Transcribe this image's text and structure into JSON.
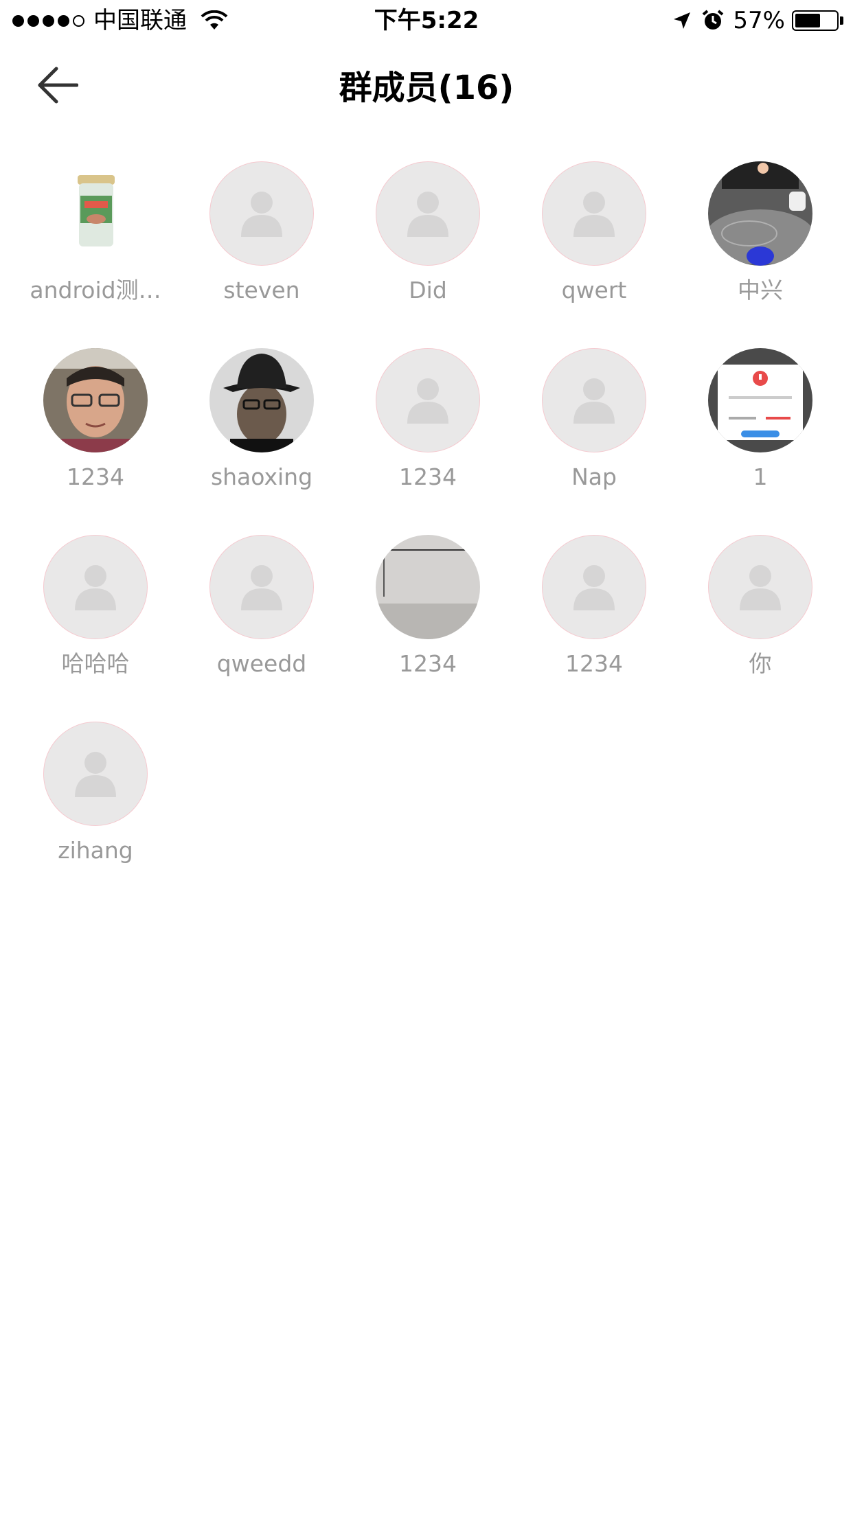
{
  "status_bar": {
    "carrier": "中国联通",
    "time": "下午5:22",
    "battery_percent": "57%",
    "battery_level": 0.57,
    "signal_bars": 4
  },
  "nav": {
    "back_icon": "arrow-left-icon",
    "title": "群成员(16)"
  },
  "members": [
    {
      "name": "android测…",
      "avatar": "photo-jar"
    },
    {
      "name": "steven",
      "avatar": "placeholder"
    },
    {
      "name": "Did",
      "avatar": "placeholder"
    },
    {
      "name": "qwert",
      "avatar": "placeholder"
    },
    {
      "name": "中兴",
      "avatar": "photo-room"
    },
    {
      "name": "1234",
      "avatar": "photo-man-glasses"
    },
    {
      "name": "shaoxing",
      "avatar": "photo-man-hat"
    },
    {
      "name": "1234",
      "avatar": "placeholder"
    },
    {
      "name": "Nap",
      "avatar": "placeholder"
    },
    {
      "name": "1",
      "avatar": "photo-screenshot-dialog"
    },
    {
      "name": "哈哈哈",
      "avatar": "placeholder"
    },
    {
      "name": "qweedd",
      "avatar": "placeholder"
    },
    {
      "name": "1234",
      "avatar": "photo-gray-wall"
    },
    {
      "name": "1234",
      "avatar": "placeholder"
    },
    {
      "name": "你",
      "avatar": "placeholder"
    },
    {
      "name": "zihang",
      "avatar": "placeholder"
    }
  ],
  "colors": {
    "placeholder_bg": "#e9e8e8",
    "placeholder_icon": "#d6d5d5",
    "name_text": "#999999"
  }
}
